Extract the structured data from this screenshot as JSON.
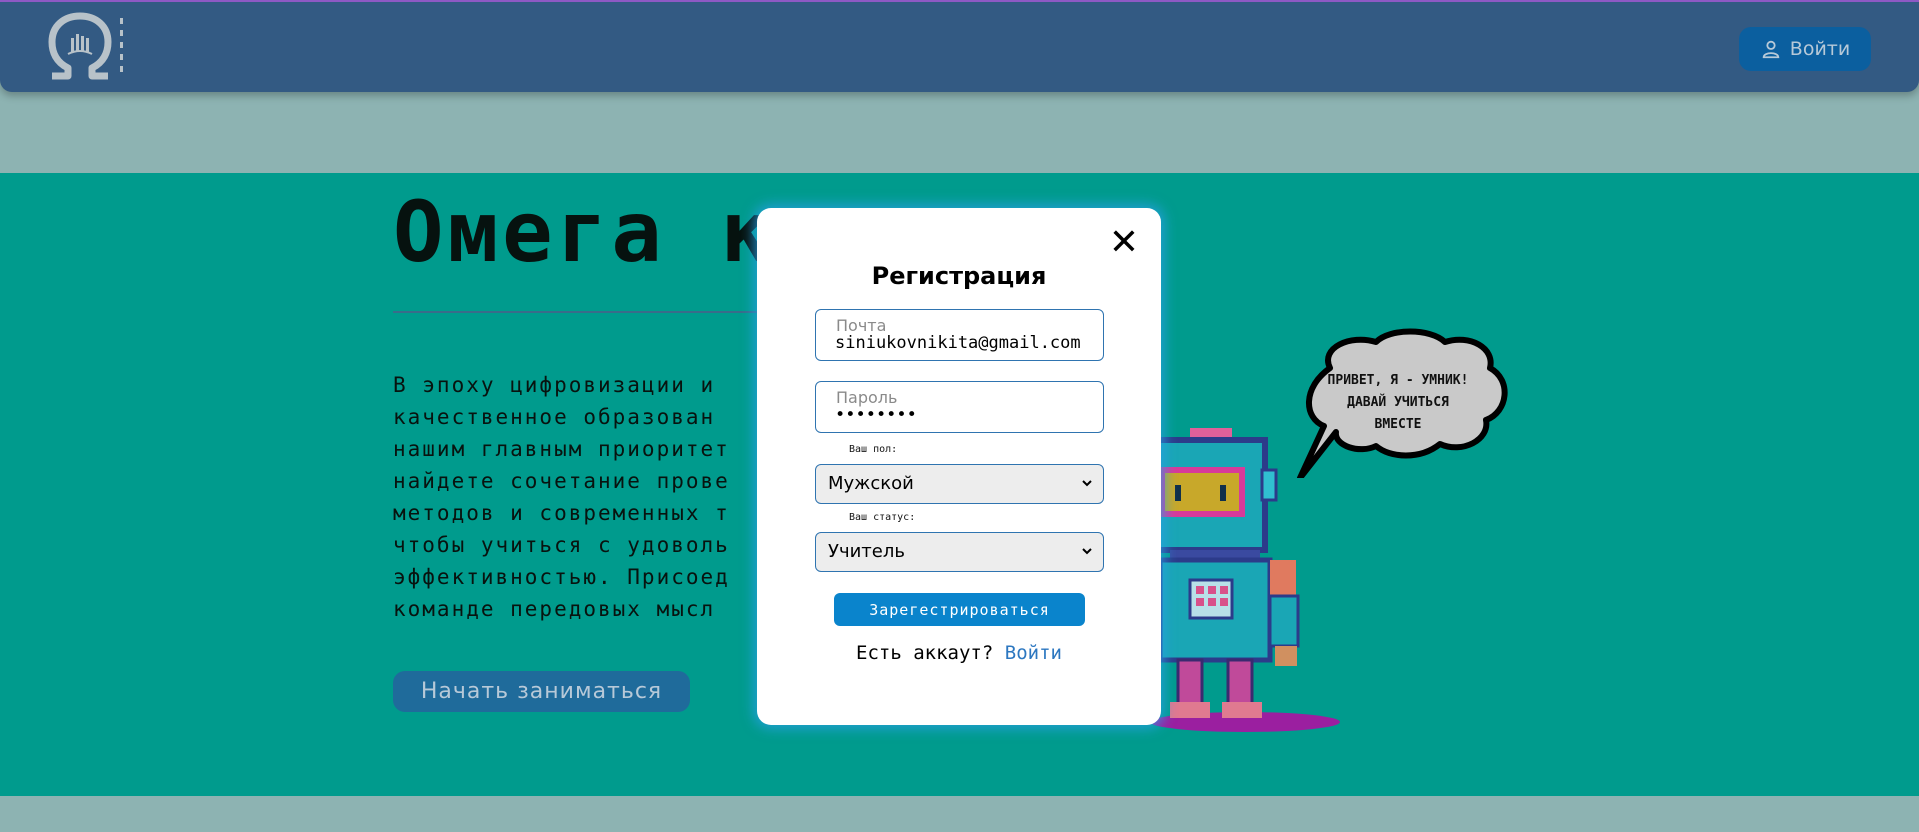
{
  "header": {
    "logo_icon": "omega-logo-icon",
    "login_button_label": "Войти",
    "login_button_icon": "user-icon"
  },
  "hero": {
    "title": "Омега кл",
    "description": "В эпоху цифровизации и\nкачественное образован\nнашим главным приоритет\nнайдете сочетание прове\nметодов и современных т\nчтобы учиться с удоволь\nэффективностью. Присоед\nкоманде передовых мысл",
    "start_button_label": "Начать заниматься"
  },
  "mascot": {
    "icon": "pixel-robot-icon",
    "speech_bubble": "ПРИВЕТ, Я - УМНИК!\nДАВАЙ УЧИТЬСЯ\nВМЕСТЕ"
  },
  "modal": {
    "title": "Регистрация",
    "close_icon": "close-icon",
    "email": {
      "label": "Почта",
      "value": "siniukovnikita@gmail.com"
    },
    "password": {
      "label": "Пароль",
      "value": "••••••••"
    },
    "gender": {
      "label": "Ваш пол:",
      "selected": "Мужской"
    },
    "status": {
      "label": "Ваш статус:",
      "selected": "Учитель"
    },
    "submit_label": "Зарегестрироваться",
    "account_prompt": "Есть аккаут?",
    "login_link": "Войти"
  },
  "colors": {
    "header_bg": "#335a83",
    "page_bg": "#8db3b2",
    "hero_bg": "#009b8d",
    "accent_button": "#0a84cc"
  }
}
